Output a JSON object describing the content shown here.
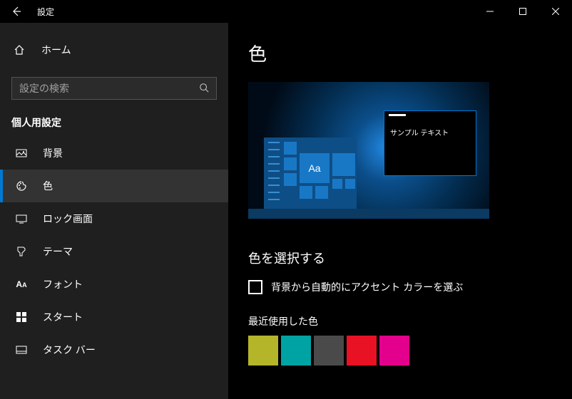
{
  "titlebar": {
    "title": "設定"
  },
  "sidebar": {
    "home": "ホーム",
    "search_placeholder": "設定の検索",
    "section": "個人用設定",
    "items": [
      {
        "label": "背景"
      },
      {
        "label": "色"
      },
      {
        "label": "ロック画面"
      },
      {
        "label": "テーマ"
      },
      {
        "label": "フォント"
      },
      {
        "label": "スタート"
      },
      {
        "label": "タスク バー"
      }
    ]
  },
  "content": {
    "heading": "色",
    "preview_sample_text": "サンプル テキスト",
    "preview_tile_aa": "Aa",
    "subheading": "色を選択する",
    "checkbox_label": "背景から自動的にアクセント カラーを選ぶ",
    "recent_heading": "最近使用した色",
    "recent_colors": [
      "#b5b52a",
      "#00a3a3",
      "#4a4a4a",
      "#e81224",
      "#e3008c"
    ]
  }
}
